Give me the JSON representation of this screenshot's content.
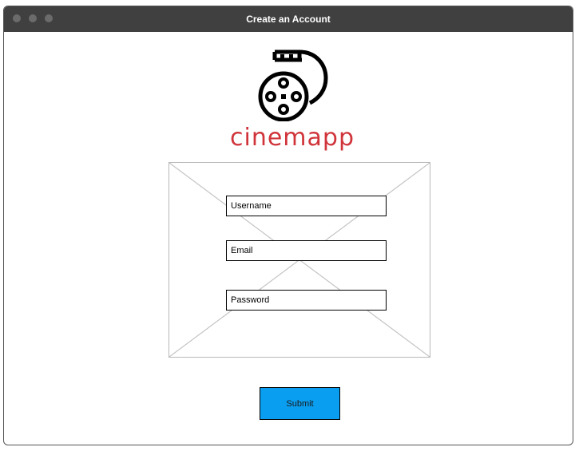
{
  "window": {
    "title": "Create an Account"
  },
  "logo": {
    "icon": "film-reel-icon",
    "text": "cinemapp",
    "color": "#d0343a"
  },
  "form": {
    "username_placeholder": "Username",
    "email_placeholder": "Email",
    "password_placeholder": "Password",
    "submit_label": "Submit"
  },
  "colors": {
    "titlebar": "#404040",
    "submit": "#0a9ef0"
  }
}
